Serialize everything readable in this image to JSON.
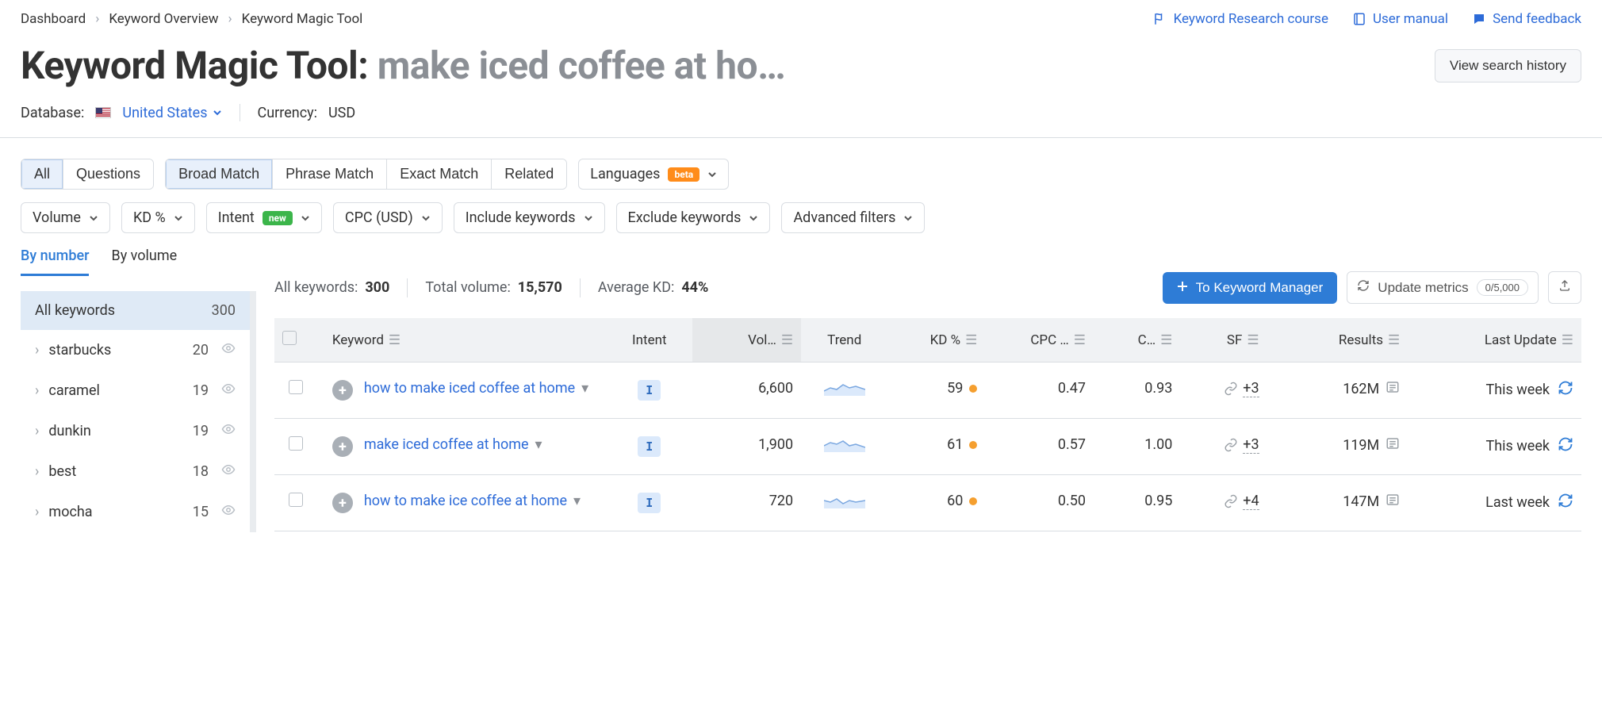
{
  "breadcrumb": [
    "Dashboard",
    "Keyword Overview",
    "Keyword Magic Tool"
  ],
  "top_links": {
    "research": "Keyword Research course",
    "manual": "User manual",
    "feedback": "Send feedback"
  },
  "title": {
    "prefix": "Keyword Magic Tool:",
    "query": "make iced coffee at ho…"
  },
  "view_history_btn": "View search history",
  "subhead": {
    "db_label": "Database:",
    "db_value": "United States",
    "cur_label": "Currency:",
    "cur_value": "USD"
  },
  "filters": {
    "all": "All",
    "questions": "Questions",
    "broad": "Broad Match",
    "phrase": "Phrase Match",
    "exact": "Exact Match",
    "related": "Related",
    "languages": "Languages",
    "languages_badge": "beta"
  },
  "filters2": {
    "volume": "Volume",
    "kd": "KD %",
    "intent": "Intent",
    "intent_badge": "new",
    "cpc": "CPC (USD)",
    "include": "Include keywords",
    "exclude": "Exclude keywords",
    "advanced": "Advanced filters"
  },
  "stats": {
    "all_kw_label": "All keywords:",
    "all_kw_value": "300",
    "total_vol_label": "Total volume:",
    "total_vol_value": "15,570",
    "avg_kd_label": "Average KD:",
    "avg_kd_value": "44%"
  },
  "actions": {
    "to_manager": "To Keyword Manager",
    "update": "Update metrics",
    "quota": "0/5,000"
  },
  "tabs": {
    "by_number": "By number",
    "by_volume": "By volume"
  },
  "side": {
    "head_label": "All keywords",
    "head_count": "300",
    "items": [
      {
        "name": "starbucks",
        "count": "20"
      },
      {
        "name": "caramel",
        "count": "19"
      },
      {
        "name": "dunkin",
        "count": "19"
      },
      {
        "name": "best",
        "count": "18"
      },
      {
        "name": "mocha",
        "count": "15"
      }
    ]
  },
  "columns": {
    "keyword": "Keyword",
    "intent": "Intent",
    "volume": "Vol…",
    "trend": "Trend",
    "kd": "KD %",
    "cpc": "CPC …",
    "com": "C…",
    "sf": "SF",
    "results": "Results",
    "updated": "Last Update"
  },
  "rows": [
    {
      "kw": "how to make iced coffee at home",
      "intent": "I",
      "vol": "6,600",
      "kd": "59",
      "cpc": "0.47",
      "com": "0.93",
      "sf": "+3",
      "results": "162M",
      "updated": "This week"
    },
    {
      "kw": "make iced coffee at home",
      "intent": "I",
      "vol": "1,900",
      "kd": "61",
      "cpc": "0.57",
      "com": "1.00",
      "sf": "+3",
      "results": "119M",
      "updated": "This week"
    },
    {
      "kw": "how to make ice coffee at home",
      "intent": "I",
      "vol": "720",
      "kd": "60",
      "cpc": "0.50",
      "com": "0.95",
      "sf": "+4",
      "results": "147M",
      "updated": "Last week"
    }
  ]
}
